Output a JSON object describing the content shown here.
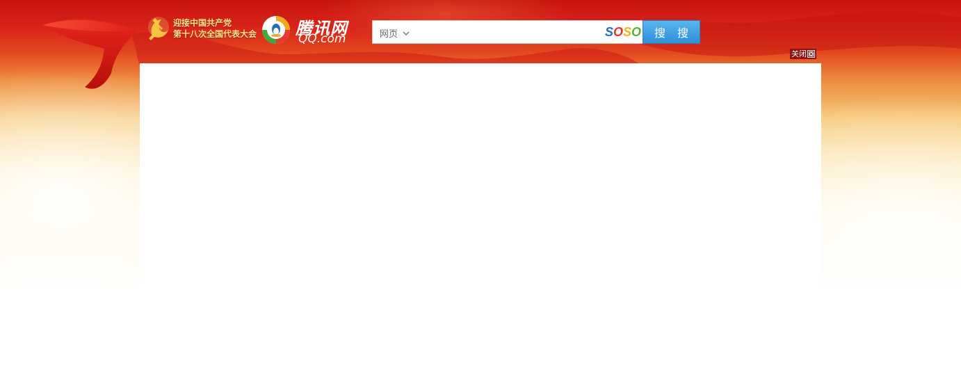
{
  "header": {
    "party_banner": {
      "line1": "迎接中国共产党",
      "line2": "第十八次全国代表大会"
    },
    "logo": {
      "cn_name": "腾讯网",
      "domain": "QQ.com",
      "icon": "qq-penguin-icon"
    }
  },
  "search": {
    "scope_label": "网页",
    "scope_icon": "chevron-down-icon",
    "input_value": "",
    "placeholder": "",
    "engine_brand": {
      "parts": [
        "S",
        "O",
        "S",
        "O"
      ],
      "colors": [
        "#1f6bc5",
        "#e6322e",
        "#f2b31b",
        "#5cae3c"
      ]
    },
    "button_label": "搜 搜",
    "button_color": "#3a9be0"
  },
  "overlay": {
    "close_label": "关闭",
    "close_icon": "close-icon"
  },
  "colors": {
    "banner_red": "#d3201a",
    "page_bg": "#ffffff"
  }
}
